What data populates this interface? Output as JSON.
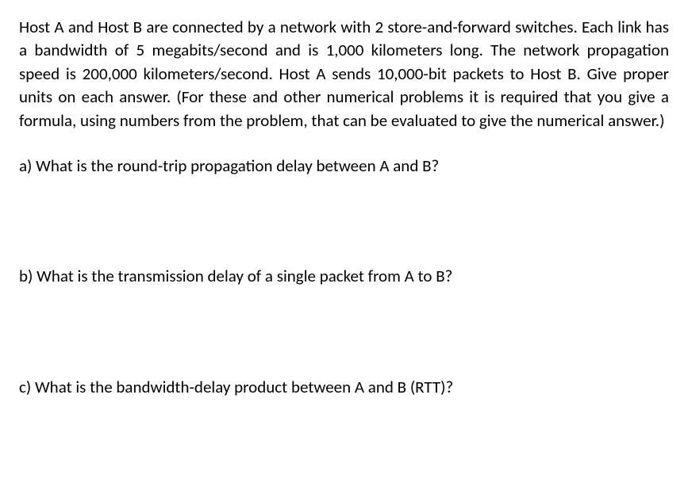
{
  "problem": {
    "intro": "Host A and Host B are connected by a network with 2 store-and-forward switches. Each link has a bandwidth of 5 megabits/second and is 1,000 kilometers long. The network propagation speed is 200,000 kilometers/second. Host A sends 10,000-bit packets to Host B. Give proper units on each answer. (For these and other numerical problems it is required that you give a formula, using numbers from the problem, that can be evaluated to give the numerical answer.)",
    "questions": {
      "a": "a) What is the round-trip propagation delay between A and B?",
      "b": "b) What is the transmission delay of a single packet from A to B?",
      "c": "c) What is the bandwidth-delay product between A and B (RTT)?"
    }
  }
}
